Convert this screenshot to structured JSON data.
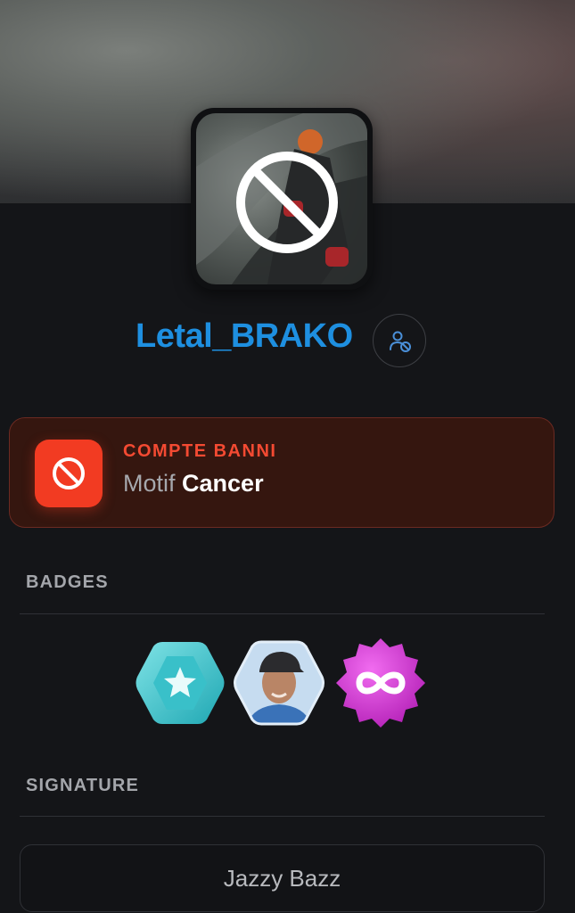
{
  "profile": {
    "username": "Letal_BRAKO",
    "username_color": "#1e8fe0",
    "avatar_status_icon": "ban-icon",
    "action_icon": "user-ban-icon"
  },
  "ban": {
    "title": "COMPTE BANNI",
    "reason_label": "Motif",
    "reason_value": "Cancer",
    "accent_color": "#f23b22",
    "icon": "ban-icon"
  },
  "sections": {
    "badges_title": "BADGES",
    "signature_title": "SIGNATURE"
  },
  "badges": [
    {
      "name": "star-hexagon-badge",
      "color": "#3cc6cf"
    },
    {
      "name": "portrait-hexagon-badge",
      "color": "#a9c8e6"
    },
    {
      "name": "infinity-badge",
      "color": "#d93cd6"
    }
  ],
  "signature": {
    "text": "Jazzy Bazz"
  }
}
